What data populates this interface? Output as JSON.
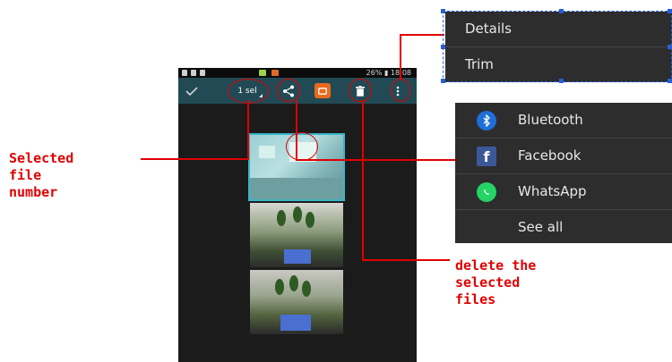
{
  "status_bar": {
    "battery": "26%",
    "time": "18:08"
  },
  "action_bar": {
    "done_icon": "check-icon",
    "selection_label": "1 sel",
    "share_icon": "share-icon",
    "slideshow_icon": "slideshow-icon",
    "delete_icon": "trash-icon",
    "overflow_icon": "more-vertical-icon"
  },
  "thumbnails": [
    {
      "name": "photo-1",
      "selected": true
    },
    {
      "name": "photo-2",
      "selected": false
    },
    {
      "name": "photo-3",
      "selected": false
    }
  ],
  "overflow_menu": {
    "items": [
      "Details",
      "Trim"
    ]
  },
  "share_menu": {
    "items": [
      {
        "label": "Bluetooth",
        "icon": "bluetooth-icon",
        "color": "#1e6fd9"
      },
      {
        "label": "Facebook",
        "icon": "facebook-icon",
        "color": "#3b5998"
      },
      {
        "label": "WhatsApp",
        "icon": "whatsapp-icon",
        "color": "#25d366"
      },
      {
        "label": "See all",
        "icon": "",
        "color": ""
      }
    ]
  },
  "annotations": {
    "selected_file_number": [
      "Selected",
      "file",
      "number"
    ],
    "delete_files": [
      "delete the",
      "selected",
      "files"
    ]
  },
  "colors": {
    "annotation": "#e00000",
    "action_bar": "#224a55",
    "menu_bg": "#2d2d2d",
    "selection_box": "#2a5fd4"
  }
}
